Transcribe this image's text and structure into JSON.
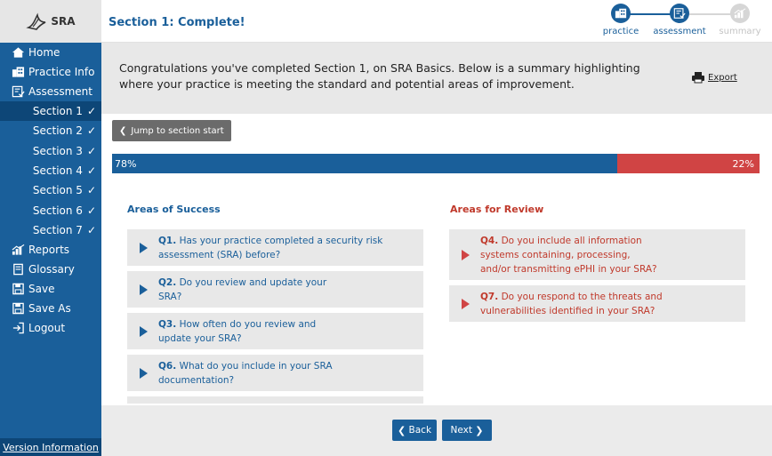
{
  "app": {
    "logo_text": "SRA"
  },
  "sidebar": {
    "items": [
      {
        "label": "Home",
        "icon": "home-icon"
      },
      {
        "label": "Practice Info",
        "icon": "building-icon"
      },
      {
        "label": "Assessment",
        "icon": "checklist-icon"
      }
    ],
    "sections": [
      {
        "label": "Section 1",
        "check": "✓",
        "active": true
      },
      {
        "label": "Section 2",
        "check": "✓"
      },
      {
        "label": "Section 3",
        "check": "✓"
      },
      {
        "label": "Section 4",
        "check": "✓"
      },
      {
        "label": "Section 5",
        "check": "✓"
      },
      {
        "label": "Section 6",
        "check": "✓"
      },
      {
        "label": "Section 7",
        "check": "✓"
      }
    ],
    "bottom_items": [
      {
        "label": "Reports",
        "icon": "chart-icon"
      },
      {
        "label": "Glossary",
        "icon": "book-icon"
      },
      {
        "label": "Save",
        "icon": "save-icon"
      },
      {
        "label": "Save As",
        "icon": "save-as-icon"
      },
      {
        "label": "Logout",
        "icon": "logout-icon"
      }
    ],
    "version_link": "Version Information"
  },
  "header": {
    "title": "Section 1:  Complete!",
    "steps": [
      {
        "label": "practice",
        "state": "done",
        "icon": "building-icon"
      },
      {
        "label": "assessment",
        "state": "current",
        "icon": "checklist-icon"
      },
      {
        "label": "summary",
        "state": "pending",
        "icon": "chart-icon"
      }
    ]
  },
  "intro": {
    "text": "Congratulations you've completed Section 1, on SRA Basics. Below is a summary highlighting where your practice is meeting the standard and potential areas of improvement.",
    "export_label": "Export"
  },
  "jump_button": "Jump to section start",
  "progress": {
    "success_label": "78%",
    "review_label": "22%",
    "success_fraction": 0.78,
    "colors": {
      "success": "#1a5f9a",
      "review": "#d04444"
    }
  },
  "success": {
    "title": "Areas of Success",
    "questions": [
      {
        "num": "Q1.",
        "text": "Has your practice completed a security risk assessment (SRA) before?"
      },
      {
        "num": "Q2.",
        "text": "Do you review and update your SRA?"
      },
      {
        "num": "Q3.",
        "text": "How often do you review and update your SRA?"
      },
      {
        "num": "Q6.",
        "text": "What do you include in your SRA documentation?"
      }
    ]
  },
  "review": {
    "title": "Areas for Review",
    "questions": [
      {
        "num": "Q4.",
        "text": "Do you include all information systems containing, processing, and/or transmitting ePHI in your SRA?"
      },
      {
        "num": "Q7.",
        "text": "Do you respond to the threats and vulnerabilities identified in your SRA?"
      }
    ]
  },
  "footer": {
    "back_label": "Back",
    "next_label": "Next",
    "back_chevron": "❮",
    "next_chevron": "❯"
  },
  "glyphs": {
    "jump_chevron": "❮"
  }
}
